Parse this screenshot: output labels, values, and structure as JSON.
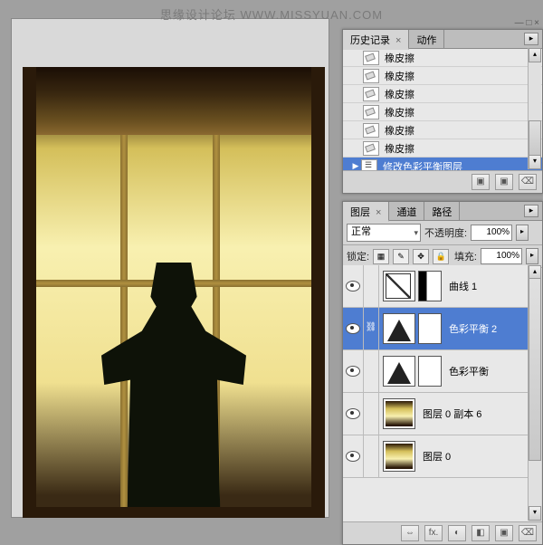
{
  "watermark": "思缘设计论坛 WWW.MISSYUAN.COM",
  "float_controls": "— □ ×",
  "history": {
    "tab1": "历史记录",
    "tab2": "动作",
    "items": [
      {
        "type": "eraser",
        "label": "橡皮擦"
      },
      {
        "type": "eraser",
        "label": "橡皮擦"
      },
      {
        "type": "eraser",
        "label": "橡皮擦"
      },
      {
        "type": "eraser",
        "label": "橡皮擦"
      },
      {
        "type": "eraser",
        "label": "橡皮擦"
      },
      {
        "type": "eraser",
        "label": "橡皮擦"
      },
      {
        "type": "adjust",
        "label": "修改色彩平衡图层",
        "selected": true
      }
    ],
    "footer": [
      "▣",
      "▣",
      "⌫"
    ]
  },
  "layers": {
    "tab1": "图层",
    "tab2": "通道",
    "tab3": "路径",
    "blend": "正常",
    "opacity_label": "不透明度:",
    "opacity": "100%",
    "lock_label": "锁定:",
    "fill_label": "填充:",
    "fill": "100%",
    "items": [
      {
        "kind": "curves",
        "mask": "split",
        "name": "曲线 1"
      },
      {
        "kind": "levels",
        "mask": "white",
        "name": "色彩平衡 2",
        "selected": true,
        "link": true
      },
      {
        "kind": "levels",
        "mask": "white",
        "name": "色彩平衡"
      },
      {
        "kind": "img",
        "name": "图层 0 副本 6"
      },
      {
        "kind": "img",
        "name": "图层 0"
      }
    ],
    "footer": [
      "⇔",
      "fx.",
      "◐",
      "◧",
      "▣",
      "⌫"
    ]
  }
}
